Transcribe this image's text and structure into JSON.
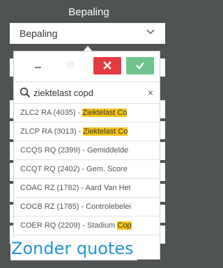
{
  "panel": {
    "title": "Bepaling",
    "select_value": "Bepaling"
  },
  "toolbar": {
    "more_label": "...",
    "cancel_icon": "close-icon",
    "ok_icon": "check-icon",
    "cancel_color": "#e23a3f",
    "ok_color": "#6fc48d"
  },
  "search": {
    "value": "ziektelast copd",
    "clear_label": "×"
  },
  "results": [
    {
      "prefix": "ZLC2 RA (4035) - ",
      "highlight": "Ziektelast Co",
      "rest": ""
    },
    {
      "prefix": "ZLCP RA (3013) - ",
      "highlight": "Ziektelast Co",
      "rest": ""
    },
    {
      "prefix": "CCQS RQ (2399) - Gemiddelde",
      "highlight": "",
      "rest": ""
    },
    {
      "prefix": "CCQT RQ (2402) - Gem. Score",
      "highlight": "",
      "rest": ""
    },
    {
      "prefix": "COAC RZ (1782) - Aard Van Het",
      "highlight": "",
      "rest": ""
    },
    {
      "prefix": "COCB RZ (1785) - Controlebelei",
      "highlight": " ",
      "rest": ""
    },
    {
      "prefix": "COER RQ (2209) - Stadium ",
      "highlight": "Cop",
      "rest": ""
    }
  ],
  "annotation": "Zonder quotes",
  "colors": {
    "highlight": "#f5c518",
    "annotation": "#2196d3",
    "background": "#505354"
  }
}
